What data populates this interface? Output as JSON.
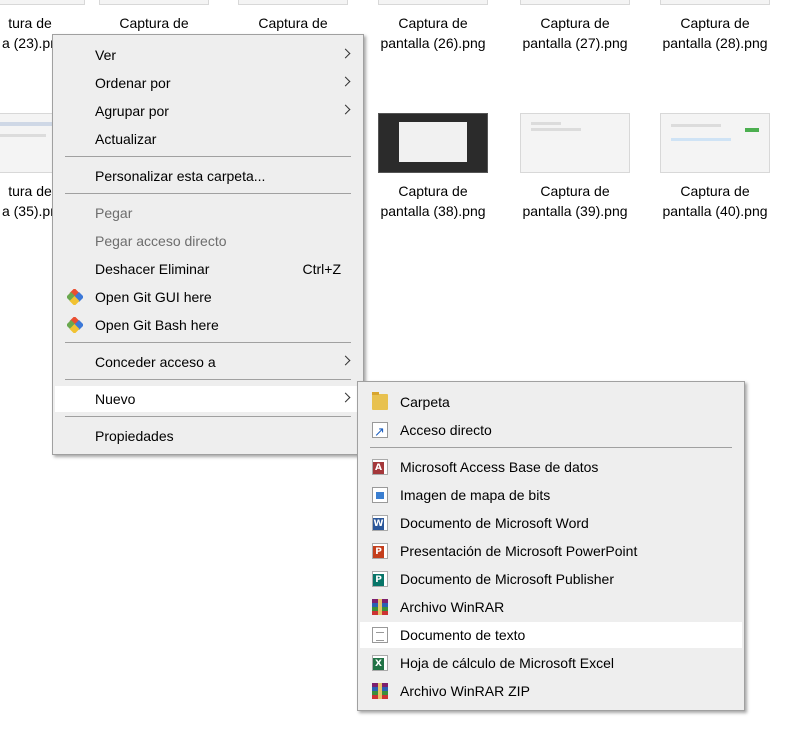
{
  "files_top": [
    {
      "line1": "tura de",
      "line2": "a (23).pn"
    },
    {
      "line1": "Captura de",
      "line2": ""
    },
    {
      "line1": "Captura de",
      "line2": ""
    },
    {
      "line1": "Captura de",
      "line2": "pantalla (26).png"
    },
    {
      "line1": "Captura de",
      "line2": "pantalla (27).png"
    },
    {
      "line1": "Captura de",
      "line2": "pantalla (28).png"
    }
  ],
  "files_mid": [
    {
      "line1": "tura de",
      "line2": "a (35).pn"
    },
    {
      "line1": "Captura de",
      "line2": "pantalla (38).png"
    },
    {
      "line1": "Captura de",
      "line2": "pantalla (39).png"
    },
    {
      "line1": "Captura de",
      "line2": "pantalla (40).png"
    }
  ],
  "context_menu": {
    "items": [
      {
        "label": "Ver"
      },
      {
        "label": "Ordenar por"
      },
      {
        "label": "Agrupar por"
      },
      {
        "label": "Actualizar"
      },
      {
        "label": "Personalizar esta carpeta..."
      },
      {
        "label": "Pegar"
      },
      {
        "label": "Pegar acceso directo"
      },
      {
        "label": "Deshacer Eliminar",
        "shortcut": "Ctrl+Z"
      },
      {
        "label": "Open Git GUI here"
      },
      {
        "label": "Open Git Bash here"
      },
      {
        "label": "Conceder acceso a"
      },
      {
        "label": "Nuevo"
      },
      {
        "label": "Propiedades"
      }
    ]
  },
  "new_submenu": {
    "items": [
      {
        "label": "Carpeta",
        "icon": "folder-icon"
      },
      {
        "label": "Acceso directo",
        "icon": "shortcut-icon"
      },
      {
        "label": "Microsoft Access Base de datos",
        "icon": "access-icon",
        "letter": "A"
      },
      {
        "label": "Imagen de mapa de bits",
        "icon": "bitmap-icon"
      },
      {
        "label": "Documento de Microsoft Word",
        "icon": "word-icon",
        "letter": "W"
      },
      {
        "label": "Presentación de Microsoft PowerPoint",
        "icon": "powerpoint-icon",
        "letter": "P"
      },
      {
        "label": "Documento de Microsoft Publisher",
        "icon": "publisher-icon",
        "letter": "P"
      },
      {
        "label": "Archivo WinRAR",
        "icon": "winrar-icon"
      },
      {
        "label": "Documento de texto",
        "icon": "text-document-icon"
      },
      {
        "label": "Hoja de cálculo de Microsoft Excel",
        "icon": "excel-icon",
        "letter": "X"
      },
      {
        "label": "Archivo WinRAR ZIP",
        "icon": "winrar-zip-icon"
      }
    ]
  },
  "colors": {
    "menu_bg": "#eeeeee",
    "highlight": "#ffffff",
    "access": "#a4373a",
    "word": "#2b579a",
    "powerpoint": "#c43e1c",
    "publisher": "#077568",
    "excel": "#217346"
  }
}
